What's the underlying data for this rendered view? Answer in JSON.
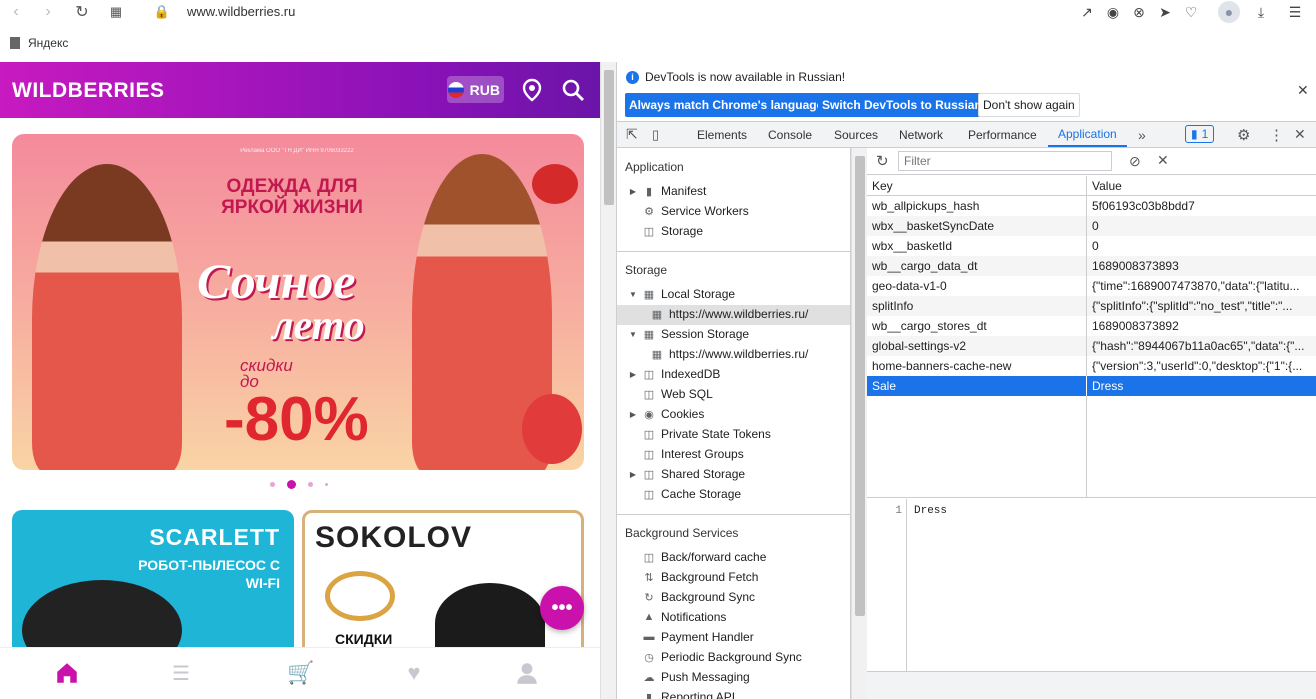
{
  "browser": {
    "url": "www.wildberries.ru",
    "bookmark": "Яндекс"
  },
  "site": {
    "logo": "WILDBERRIES",
    "currency": "RUB",
    "banner": {
      "legal": "Реклама ООО \"ТН ДИ\" ИНН 9706033222",
      "headline": "ОДЕЖДА ДЛЯ ЯРКОЙ ЖИЗНИ",
      "title_line1": "Сочное",
      "title_line2": "лето",
      "discount_label": "скидки до",
      "discount": "-80%"
    },
    "card1": {
      "brand": "SCARLETT",
      "desc": "РОБОТ-ПЫЛЕСОС С WI-FI"
    },
    "card2": {
      "brand": "SOKOLOV",
      "desc": "СКИДКИ"
    }
  },
  "devtools": {
    "info_message": "DevTools is now available in Russian!",
    "btn_match": "Always match Chrome's language",
    "btn_switch": "Switch DevTools to Russian",
    "btn_dont_show": "Don't show again",
    "tabs": [
      "Elements",
      "Console",
      "Sources",
      "Network",
      "Performance",
      "Application"
    ],
    "issues_count": "1",
    "sidebar": {
      "application_title": "Application",
      "application_items": [
        "Manifest",
        "Service Workers",
        "Storage"
      ],
      "storage_title": "Storage",
      "local_storage": "Local Storage",
      "local_storage_origin": "https://www.wildberries.ru/",
      "session_storage": "Session Storage",
      "session_storage_origin": "https://www.wildberries.ru/",
      "storage_items": [
        "IndexedDB",
        "Web SQL",
        "Cookies",
        "Private State Tokens",
        "Interest Groups",
        "Shared Storage",
        "Cache Storage"
      ],
      "background_title": "Background Services",
      "background_items": [
        "Back/forward cache",
        "Background Fetch",
        "Background Sync",
        "Notifications",
        "Payment Handler",
        "Periodic Background Sync",
        "Push Messaging",
        "Reporting API"
      ]
    },
    "filter_placeholder": "Filter",
    "table": {
      "col_key": "Key",
      "col_value": "Value",
      "rows": [
        {
          "key": "wb_allpickups_hash",
          "value": "5f06193c03b8bdd7"
        },
        {
          "key": "wbx__basketSyncDate",
          "value": "0"
        },
        {
          "key": "wbx__basketId",
          "value": "0"
        },
        {
          "key": "wb__cargo_data_dt",
          "value": "1689008373893"
        },
        {
          "key": "geo-data-v1-0",
          "value": "{\"time\":1689007473870,\"data\":{\"latitu..."
        },
        {
          "key": "splitInfo",
          "value": "{\"splitInfo\":{\"splitId\":\"no_test\",\"title\":\"..."
        },
        {
          "key": "wb__cargo_stores_dt",
          "value": "1689008373892"
        },
        {
          "key": "global-settings-v2",
          "value": "{\"hash\":\"8944067b11a0ac65\",\"data\":{\"..."
        },
        {
          "key": "home-banners-cache-new",
          "value": "{\"version\":3,\"userId\":0,\"desktop\":{\"1\":{..."
        },
        {
          "key": "Sale",
          "value": "Dress"
        }
      ]
    },
    "preview_line_number": "1",
    "preview_value": "Dress"
  }
}
